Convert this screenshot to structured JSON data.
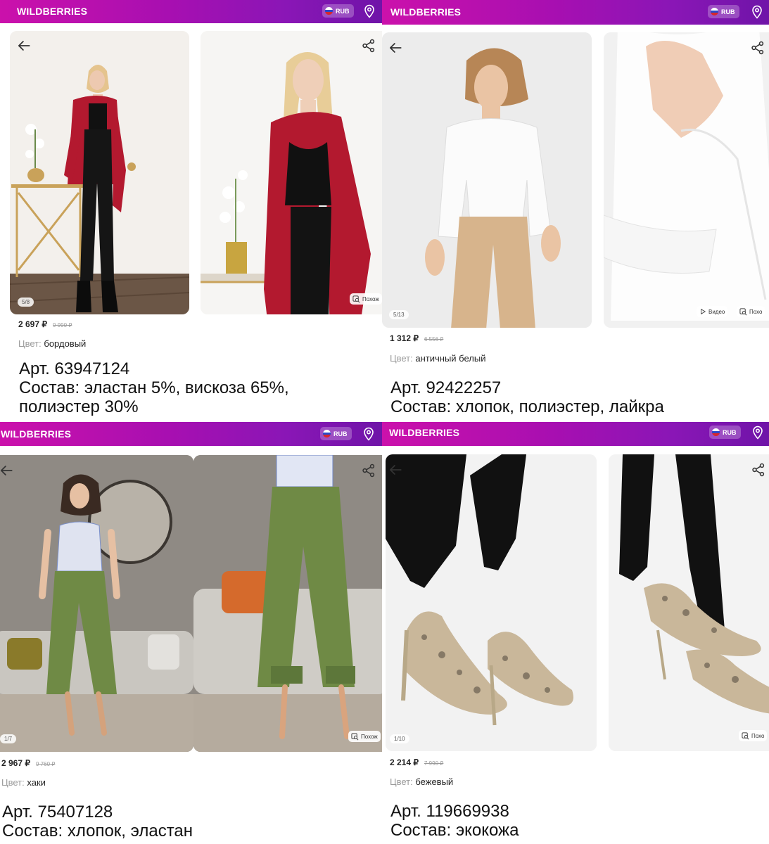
{
  "colors": {
    "brand_gradient_start": "#cb11ab",
    "brand_gradient_end": "#6f14a8",
    "price": "#242424",
    "muted": "#9a9a9a"
  },
  "header": {
    "logo": "WILDBERRIES",
    "currency": "RUB",
    "flag_icon": "russia-flag-icon",
    "location_icon": "location-pin-icon"
  },
  "products": [
    {
      "counter": "5/8",
      "similar_label": "Похож",
      "price": "2 697 ₽",
      "old_price": "9 990 ₽",
      "color_label": "Цвет:",
      "color_value": "бордовый",
      "caption_line1": "Арт. 63947124",
      "caption_line2": "Состав: эластан 5%, вискоза 65%,",
      "caption_line3": "полиэстер 30%"
    },
    {
      "counter": "5/13",
      "video_label": "Видео",
      "similar_label": "Похо",
      "price": "1 312 ₽",
      "old_price": "6 556 ₽",
      "color_label": "Цвет:",
      "color_value": "античный белый",
      "caption_line1": "Арт. 92422257",
      "caption_line2": "Состав: хлопок, полиэстер, лайкра"
    },
    {
      "counter": "1/7",
      "similar_label": "Похож",
      "price": "2 967 ₽",
      "old_price": "9 760 ₽",
      "color_label": "Цвет:",
      "color_value": "хаки",
      "caption_line1": "Арт. 75407128",
      "caption_line2": "Состав: хлопок, эластан"
    },
    {
      "counter": "1/10",
      "similar_label": "Похо",
      "price": "2 214 ₽",
      "old_price": "7 990 ₽",
      "color_label": "Цвет:",
      "color_value": "бежевый",
      "caption_line1": "Арт. 119669938",
      "caption_line2": "Состав: экокожа"
    }
  ]
}
